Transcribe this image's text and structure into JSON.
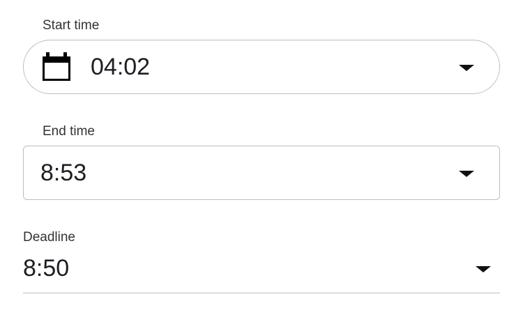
{
  "start_time": {
    "label": "Start time",
    "value": "04:02",
    "icon": "calendar-icon"
  },
  "end_time": {
    "label": "End time",
    "value": "8:53"
  },
  "deadline": {
    "label": "Deadline",
    "value": "8:50"
  }
}
